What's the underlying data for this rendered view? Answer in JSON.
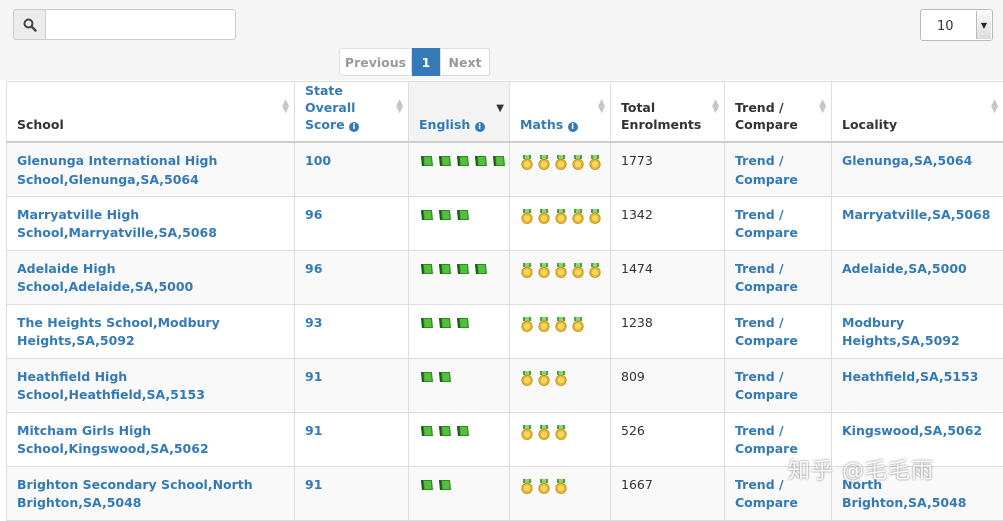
{
  "search": {
    "value": "",
    "placeholder": ""
  },
  "page_length": {
    "selected": "10"
  },
  "pagination": {
    "previous": "Previous",
    "current": "1",
    "next": "Next"
  },
  "table": {
    "columns": [
      "School",
      "State Overall Score",
      "English",
      "Maths",
      "Total Enrolments",
      "Trend / Compare",
      "Locality"
    ],
    "sorted_column": "English",
    "rows": [
      {
        "school": "Glenunga International High School,Glenunga,SA,5064",
        "score": "100",
        "english_books": 5,
        "maths_medals": 5,
        "enrolments": "1773",
        "trend": "Trend / Compare",
        "locality": "Glenunga,SA,5064"
      },
      {
        "school": "Marryatville High School,Marryatville,SA,5068",
        "score": "96",
        "english_books": 3,
        "maths_medals": 5,
        "enrolments": "1342",
        "trend": "Trend / Compare",
        "locality": "Marryatville,SA,5068"
      },
      {
        "school": "Adelaide High School,Adelaide,SA,5000",
        "score": "96",
        "english_books": 4,
        "maths_medals": 5,
        "enrolments": "1474",
        "trend": "Trend / Compare",
        "locality": "Adelaide,SA,5000"
      },
      {
        "school": "The Heights School,Modbury Heights,SA,5092",
        "score": "93",
        "english_books": 3,
        "maths_medals": 4,
        "enrolments": "1238",
        "trend": "Trend / Compare",
        "locality": "Modbury Heights,SA,5092"
      },
      {
        "school": "Heathfield High School,Heathfield,SA,5153",
        "score": "91",
        "english_books": 2,
        "maths_medals": 3,
        "enrolments": "809",
        "trend": "Trend / Compare",
        "locality": "Heathfield,SA,5153"
      },
      {
        "school": "Mitcham Girls High School,Kingswood,SA,5062",
        "score": "91",
        "english_books": 3,
        "maths_medals": 3,
        "enrolments": "526",
        "trend": "Trend / Compare",
        "locality": "Kingswood,SA,5062"
      },
      {
        "school": "Brighton Secondary School,North Brighton,SA,5048",
        "score": "91",
        "english_books": 2,
        "maths_medals": 3,
        "enrolments": "1667",
        "trend": "Trend / Compare",
        "locality": "North Brighton,SA,5048"
      }
    ]
  },
  "icons": {
    "search": "search-icon",
    "info": "info-icon",
    "english": "book-icon",
    "maths": "medal-icon",
    "sort": "sort-icon"
  },
  "colors": {
    "link": "#337ab7",
    "book": "#3c9a2c",
    "medal": "#e9b82a"
  },
  "watermark": "知乎 @毛毛雨"
}
